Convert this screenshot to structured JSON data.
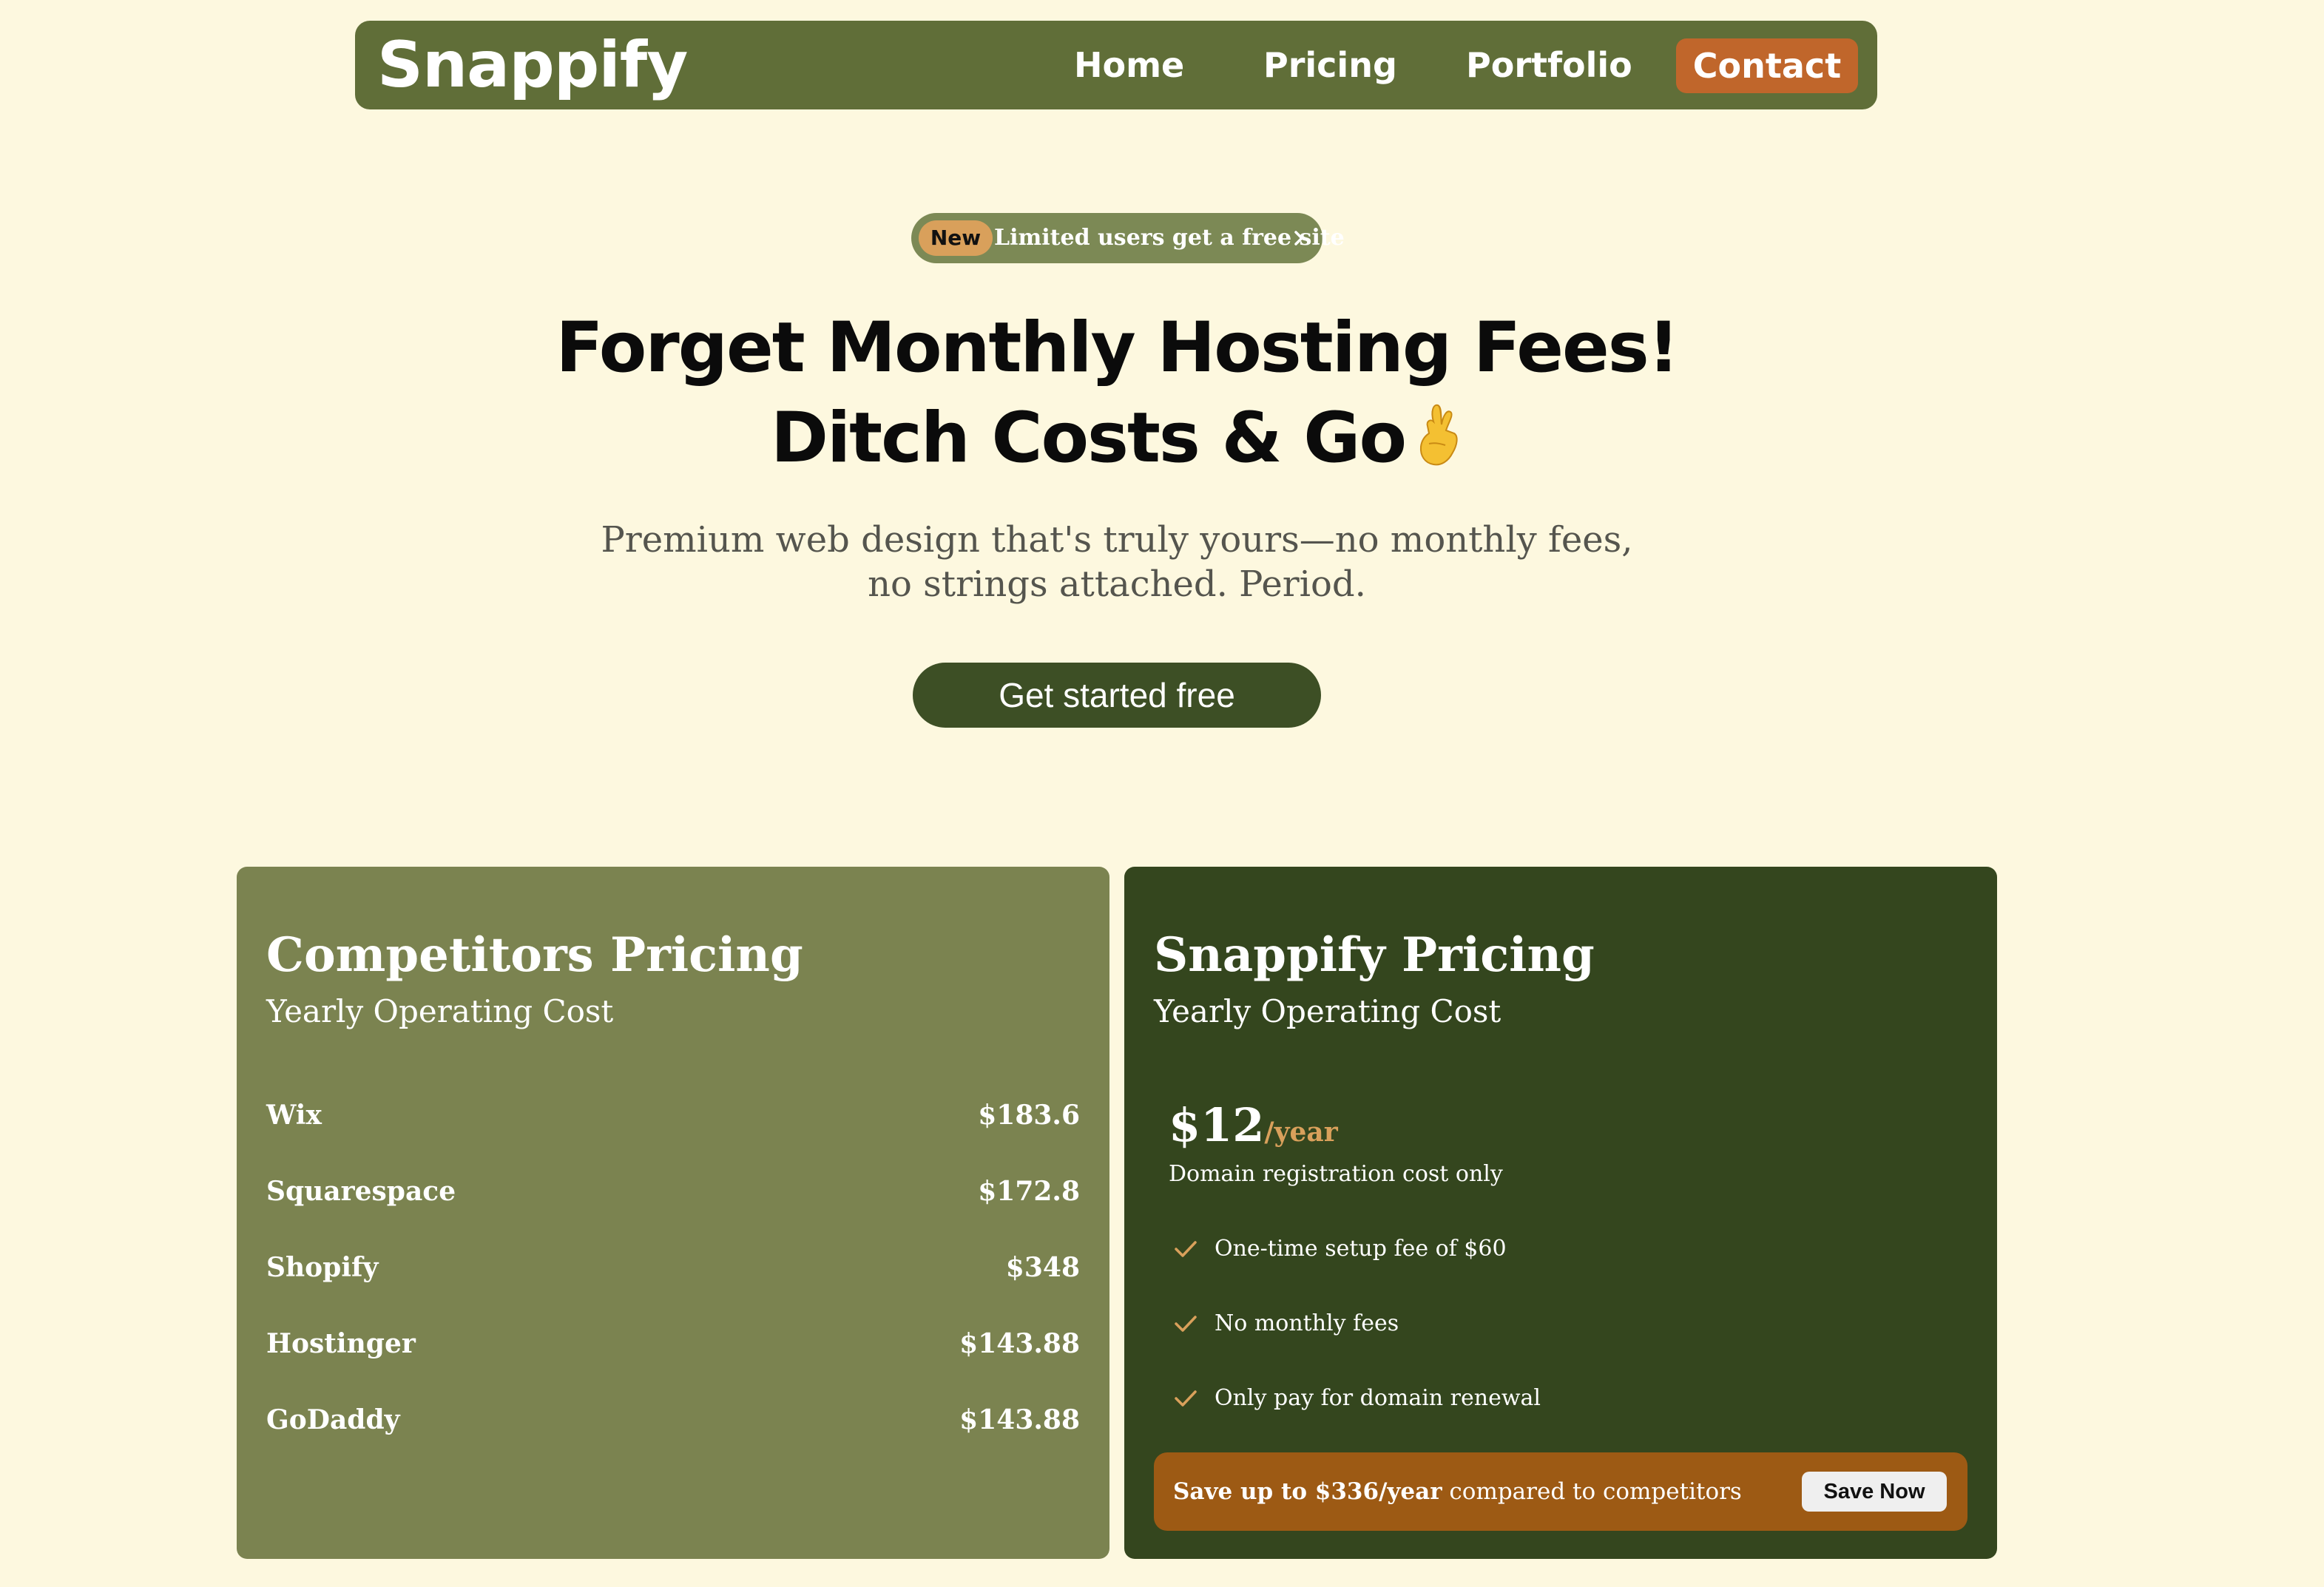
{
  "nav": {
    "logo": "Snappify",
    "links": [
      {
        "label": "Home"
      },
      {
        "label": "Pricing"
      },
      {
        "label": "Portfolio"
      }
    ],
    "contact_label": "Contact"
  },
  "hero": {
    "badge_tag": "New",
    "badge_text": "Limited users get a free site",
    "headline_line1": "Forget Monthly Hosting Fees!",
    "headline_line2": "Ditch Costs & Go",
    "headline_emoji": "crossed-fingers",
    "subhead_line1": "Premium web design that's truly yours—no monthly fees,",
    "subhead_line2": "no strings attached. Period.",
    "cta_label": "Get started free"
  },
  "competitors": {
    "title": "Competitors Pricing",
    "subtitle": "Yearly Operating Cost",
    "rows": [
      {
        "name": "Wix",
        "price": "$183.6"
      },
      {
        "name": "Squarespace",
        "price": "$172.8"
      },
      {
        "name": "Shopify",
        "price": "$348"
      },
      {
        "name": "Hostinger",
        "price": "$143.88"
      },
      {
        "name": "GoDaddy",
        "price": "$143.88"
      }
    ]
  },
  "snappify": {
    "title": "Snappify Pricing",
    "subtitle": "Yearly Operating Cost",
    "price": "$12",
    "price_unit": "/year",
    "price_note": "Domain registration cost only",
    "features": [
      "One-time setup fee of $60",
      "No monthly fees",
      "Only pay for domain renewal"
    ],
    "save_strong": "Save up to $336/year",
    "save_rest": " compared to competitors",
    "save_button": "Save Now"
  },
  "colors": {
    "page_bg": "#fdf8df",
    "nav_bg": "#606e38",
    "contact_bg": "#c0662b",
    "cta_bg": "#3d4f25",
    "competitors_card": "#7b8350",
    "snappify_card": "#34461e",
    "accent": "#d9a05b",
    "save_bar": "#9d5a14"
  }
}
